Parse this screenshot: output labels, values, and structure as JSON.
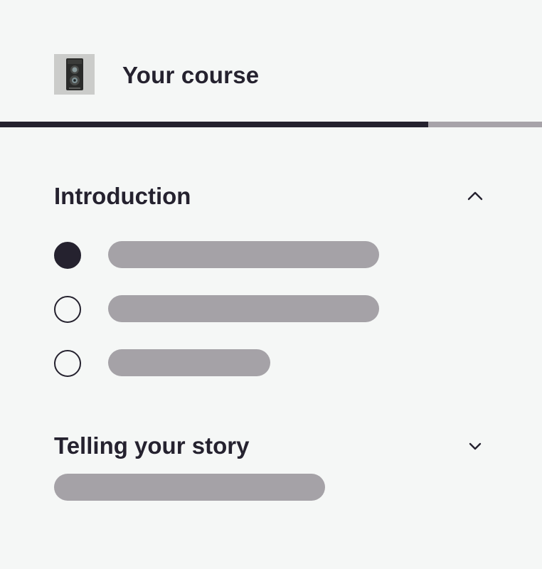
{
  "header": {
    "title": "Your course",
    "thumbnail_icon": "camera-icon",
    "progress_fraction": 0.79
  },
  "sections": [
    {
      "title": "Introduction",
      "expanded": true,
      "chevron_icon": "chevron-up-icon",
      "lessons": [
        {
          "state": "current",
          "placeholder_fraction": 0.82
        },
        {
          "state": "not-started",
          "placeholder_fraction": 0.82
        },
        {
          "state": "not-started",
          "placeholder_fraction": 0.49
        }
      ]
    },
    {
      "title": "Telling your story",
      "expanded": false,
      "chevron_icon": "chevron-down-icon"
    }
  ],
  "colors": {
    "background": "#f5f7f6",
    "text": "#25222f",
    "progress_track": "#a7a3a9",
    "skeleton": "#a5a2a7"
  }
}
